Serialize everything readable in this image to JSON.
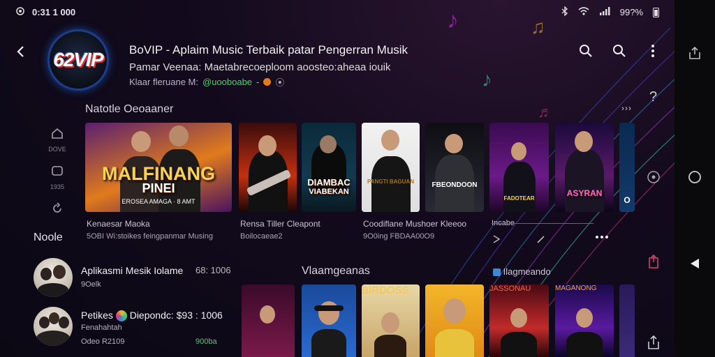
{
  "status_bar": {
    "time": "0:31 1 000",
    "battery": "99?%"
  },
  "header": {
    "logo_text": "62VIP",
    "title": "BoVIP - Aplaim Music Terbaik patar Pengerran Musik",
    "subtitle": "Pamar Veenaa: Maetabrecoeploom aoosteo:aheaa iouik",
    "meta_prefix": "Klaar fleruane M:",
    "meta_highlight": "@uooboabe",
    "meta_suffix": "-"
  },
  "rail": [
    {
      "icon": "home-icon",
      "label": "DOVE"
    },
    {
      "icon": "library-icon",
      "label": "1935"
    },
    {
      "icon": "refresh-icon",
      "label": ""
    }
  ],
  "sections": {
    "featured_title": "Natotle Oeoaaner",
    "more": "›››",
    "left_title": "Noole",
    "mid_title": "Vlaamgeanas",
    "right_title": "Ilagmeando"
  },
  "featured_cards": [
    {
      "cover": "MALFINANG",
      "cover2": "PINEI",
      "sub": "EROSEA AMAGA · 8 AMT"
    },
    {
      "cover": "",
      "sub": ""
    },
    {
      "cover": "DIAMBAC",
      "cover2": "VIABEKAN",
      "sub": ""
    },
    {
      "cover": "",
      "sub": "PANGTI BAGUAN"
    },
    {
      "cover": "",
      "sub": "FBEONDOON"
    },
    {
      "cover": "",
      "sub": "FADOTEAR"
    },
    {
      "cover": "",
      "sub": "ASYRAN"
    },
    {
      "cover": "",
      "sub": "O"
    }
  ],
  "featured_texts": [
    {
      "title": "Kenaesar Maoka",
      "meta": "5OBI Wi:stoikes feingpanmar Musing"
    },
    {
      "title": "Rensa Tiller Cleapont",
      "meta": "Boilocaeae2"
    },
    {
      "title": "Coodiflane Mushoer Kleeoo",
      "meta": "9O0ing FBDAA00O9"
    },
    {
      "title": "Incabe",
      "meta": ""
    }
  ],
  "list_items": [
    {
      "name": "Aplikasmi Mesik Iolame",
      "count": "68: 1006",
      "info": "9Oelk"
    },
    {
      "name": "Petikes",
      "name2": "Diepondc: $93 : 1006",
      "info": "Fenahahtah",
      "info2": "Odeo R2109",
      "count": "900ba"
    }
  ],
  "second_cards": [
    {
      "cover": ""
    },
    {
      "cover": ""
    },
    {
      "cover": "BIRDOSS"
    },
    {
      "cover": ""
    },
    {
      "cover": "JASSONAU"
    },
    {
      "cover": "MAGANONG"
    }
  ],
  "colors": {
    "accent": "#e8b53a",
    "bg": "#120a1c",
    "green": "#4bd36b"
  }
}
